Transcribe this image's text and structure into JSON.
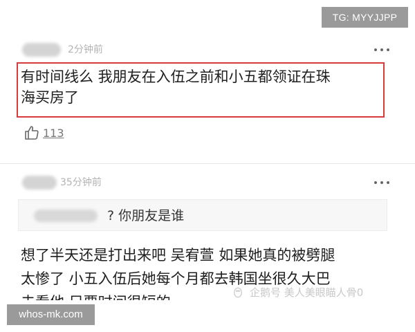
{
  "badges": {
    "telegram": "TG: MYYJJPP",
    "site": "whos-mk.com"
  },
  "comments": [
    {
      "author_blurred": true,
      "timestamp": "2分钟前",
      "line1": "有时间线么 我朋友在入伍之前和小五都领证在珠",
      "line2": "海买房了",
      "highlighted": true,
      "likes": "113"
    },
    {
      "author_blurred": true,
      "timestamp": "35分钟前",
      "reply_to": "? 你朋友是谁",
      "line1": "想了半天还是打出来吧 吴宥萱 如果她真的被劈腿",
      "line2": "太惨了 小五入伍后她每个月都去韩国坐很久大巴",
      "line3": "去看他 只要时间很短的"
    }
  ],
  "watermark": "企鹅号 美人美眼瞄人骨0",
  "icons": {
    "more": "more-dots-icon",
    "like": "thumbs-up-icon",
    "watermark": "penguin-logo-icon"
  },
  "colors": {
    "highlight_border": "#d63a3a",
    "badge_bg": "#9a9a9a",
    "muted_text": "#b3b3b3"
  }
}
